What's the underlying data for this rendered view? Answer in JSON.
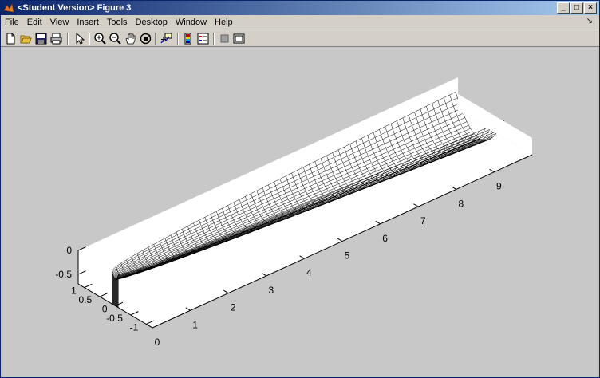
{
  "window": {
    "title": "<Student Version> Figure 3",
    "buttons": [
      "_",
      "□",
      "×"
    ]
  },
  "menu": [
    "File",
    "Edit",
    "View",
    "Insert",
    "Tools",
    "Desktop",
    "Window",
    "Help"
  ],
  "toolbar_icons": [
    "new-figure-icon",
    "open-file-icon",
    "save-icon",
    "print-icon",
    "select-arrow-icon",
    "zoom-in-icon",
    "zoom-out-icon",
    "pan-hand-icon",
    "rotate-3d-icon",
    "data-cursor-icon",
    "colorbar-icon",
    "legend-icon",
    "hide-plot-tools-icon",
    "show-plot-tools-icon"
  ],
  "chart_data": {
    "type": "surface",
    "style": "wireframe mesh on white box axes, 3-D view",
    "x_ticks": [
      "0",
      "1",
      "2",
      "3",
      "4",
      "5",
      "6",
      "7",
      "8",
      "9"
    ],
    "y_ticks": [
      "1",
      "0.5",
      "0",
      "-0.5",
      "-1"
    ],
    "z_ticks": [
      "0",
      "-0.5"
    ],
    "xlim": [
      0,
      10
    ],
    "ylim": [
      -1.2,
      1.2
    ],
    "zlim": [
      -0.7,
      0
    ],
    "mesh_color": "#000000",
    "box_color": "#ffffff",
    "background_color": "#c8c8c8"
  }
}
